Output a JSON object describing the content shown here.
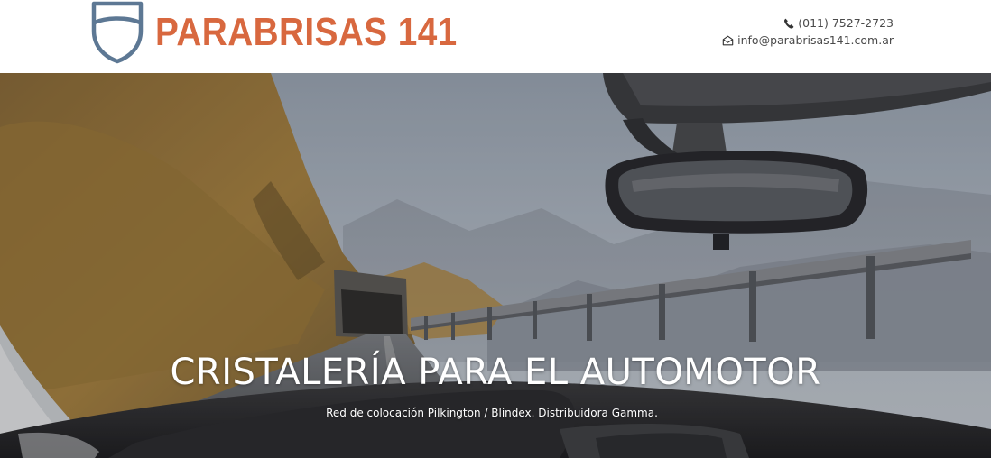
{
  "brand": {
    "name": "PARABRISAS 141",
    "color": "#d8683f",
    "shield_color": "#5d7894"
  },
  "contact": {
    "phone": "(011) 7527-2723",
    "phone_icon": "phone-icon",
    "email": "info@parabrisas141.com.ar",
    "email_icon": "envelope-open-icon"
  },
  "hero": {
    "title": "CRISTALERÍA PARA EL AUTOMOTOR",
    "subtitle": "Red de colocación Pilkington / Blindex. Distribuidora Gamma.",
    "background": "windshield-mountain-road-photo"
  }
}
